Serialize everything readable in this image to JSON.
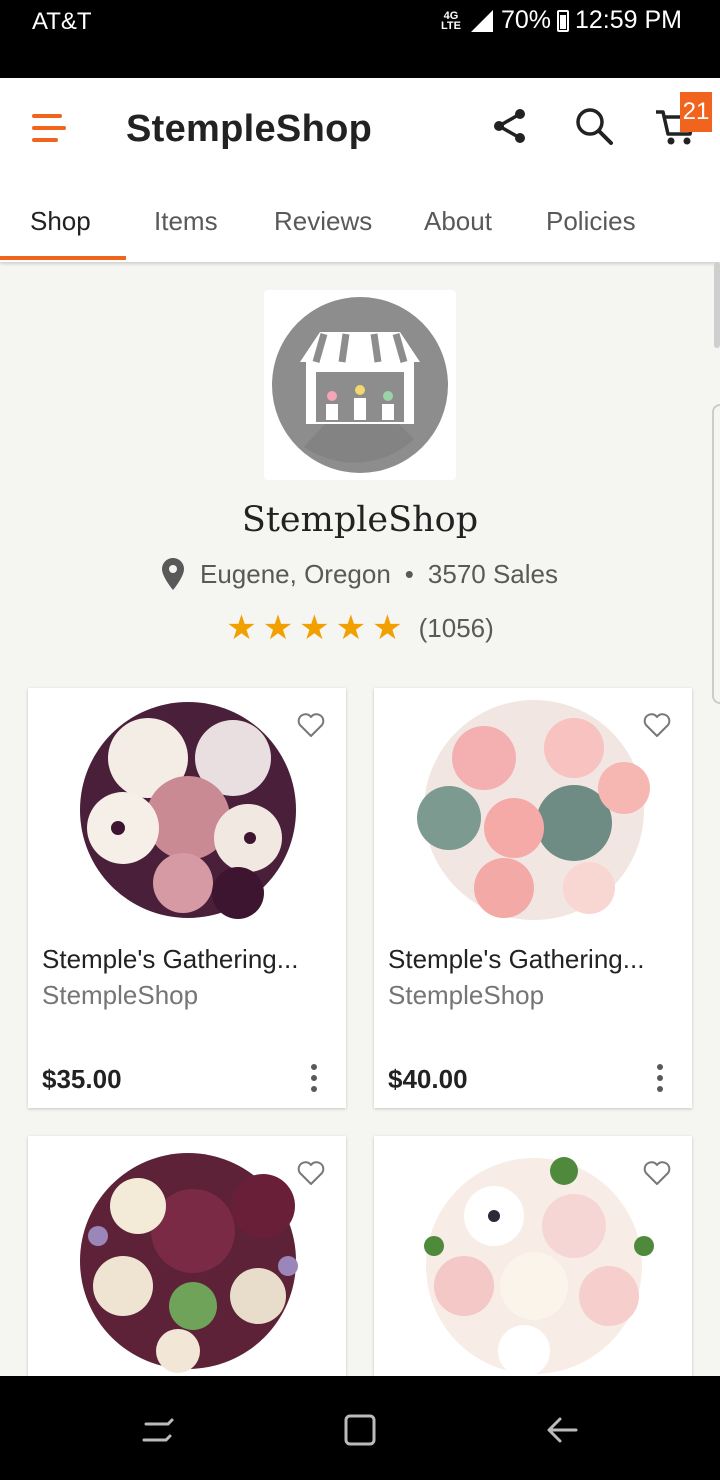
{
  "status_bar": {
    "carrier": "AT&T",
    "network_top": "4G",
    "network_bottom": "LTE",
    "battery": "70%",
    "time": "12:59 PM"
  },
  "app_bar": {
    "title": "StempleShop",
    "cart_count": "21",
    "accent": "#f1641e"
  },
  "tabs": [
    {
      "label": "Shop",
      "active": true
    },
    {
      "label": "Items"
    },
    {
      "label": "Reviews"
    },
    {
      "label": "About"
    },
    {
      "label": "Policies"
    }
  ],
  "shop": {
    "name": "StempleShop",
    "location": "Eugene, Oregon",
    "separator": "•",
    "sales": "3570 Sales",
    "stars": "★★★★★",
    "star_color": "#f1a000",
    "review_count": "(1056)"
  },
  "listings": [
    {
      "title": "Stemple's Gathering...",
      "seller": "StempleShop",
      "price": "$35.00",
      "image": "plum-calla-anemone-bouquet"
    },
    {
      "title": "Stemple's Gathering...",
      "seller": "StempleShop",
      "price": "$40.00",
      "image": "pink-peony-succulent-bouquet"
    },
    {
      "image": "burgundy-rose-lavender-bouquet"
    },
    {
      "image": "blush-anemone-rose-bouquet"
    }
  ],
  "icons": {
    "menu": "menu-icon",
    "share": "share-icon",
    "search": "search-icon",
    "cart": "cart-icon",
    "location": "location-pin-icon",
    "favorite": "heart-icon",
    "more": "more-vert-icon"
  }
}
